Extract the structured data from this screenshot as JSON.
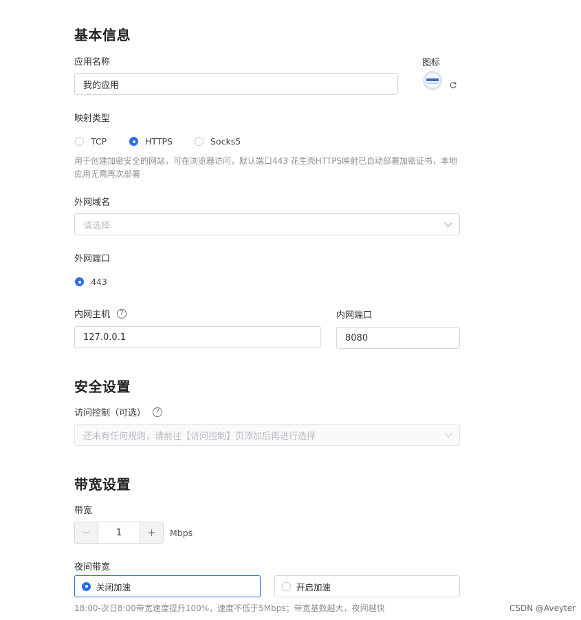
{
  "basic": {
    "title": "基本信息",
    "app_name_label": "应用名称",
    "app_name_value": "我的应用",
    "icon_label": "图标",
    "mapping_type_label": "映射类型",
    "mapping_options": [
      "TCP",
      "HTTPS",
      "Socks5"
    ],
    "mapping_selected": "HTTPS",
    "https_desc_line1": "用于创建加密安全的网站，可在浏览器访问，默认端口443 花生壳HTTPS映射已自动部署加密证书，本地",
    "https_desc_line2": "应用无需再次部署",
    "domain_label": "外网域名",
    "domain_placeholder": "请选择",
    "port_label": "外网端口",
    "port_option": "443",
    "host_label": "内网主机",
    "host_value": "127.0.0.1",
    "inner_port_label": "内网端口",
    "inner_port_value": "8080"
  },
  "security": {
    "title": "安全设置",
    "access_label": "访问控制（可选）",
    "access_placeholder": "还未有任何规则，请前往【访问控制】页添加后再进行选择"
  },
  "bandwidth": {
    "title": "带宽设置",
    "bandwidth_label": "带宽",
    "bandwidth_value": "1",
    "bandwidth_unit": "Mbps",
    "minus": "−",
    "plus": "+",
    "night_label": "夜间带宽",
    "night_options": [
      "关闭加速",
      "开启加速"
    ],
    "night_selected": "关闭加速",
    "night_desc": "18:00-次日8:00带宽速度提升100%，速度不低于5Mbps；带宽基数越大，夜间越快"
  },
  "watermark": "CSDN @Aveyter",
  "help_glyph": "?",
  "colors": {
    "accent": "#2a6ee8",
    "border": "#d4d7de",
    "muted": "#8a8e96"
  }
}
